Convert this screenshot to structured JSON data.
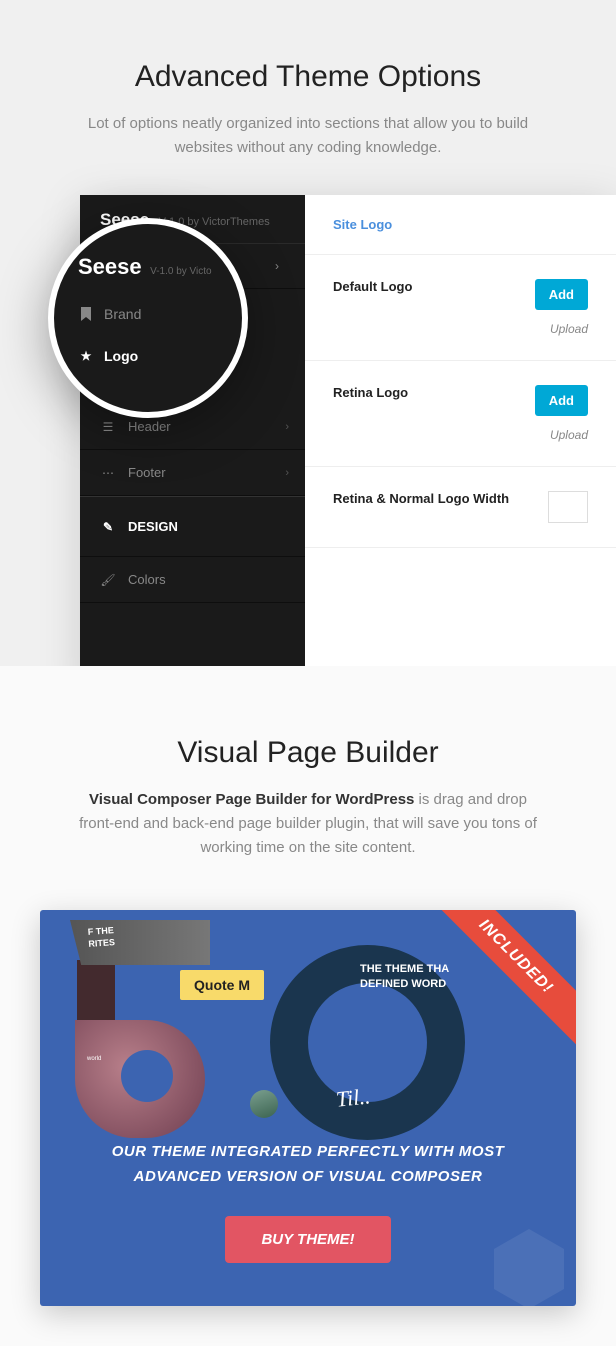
{
  "section1": {
    "title": "Advanced Theme Options",
    "subtitle": "Lot of options neatly organized into sections that allow you to build websites without any coding knowledge."
  },
  "magnifier": {
    "name": "Seese",
    "version": "V-1.0 by Victo",
    "item_brand": "Brand",
    "item_logo": "Logo"
  },
  "sidebar": {
    "name": "Seese",
    "version": "V-1.0 by VictorThemes",
    "items": {
      "top": "",
      "header": "Header",
      "footer": "Footer",
      "design": "DESIGN",
      "colors": "Colors"
    }
  },
  "content": {
    "section_label": "Site Logo",
    "default_logo": "Default Logo",
    "retina_logo": "Retina Logo",
    "width_label": "Retina & Normal Logo Width",
    "add_btn": "Add",
    "upload_hint": "Upload"
  },
  "section2": {
    "title": "Visual Page Builder",
    "bold": "Visual Composer Page Builder for WordPress",
    "rest": " is drag and drop front-end and back-end page builder plugin, that will save you tons of working time on the site content."
  },
  "banner": {
    "ribbon": "INCLUDED!",
    "quote": "Quote M",
    "tag2_l1": "THE THEME THA",
    "tag2_l2": "DEFINED WORD",
    "rib_l1": "F THE",
    "rib_l2": "RITES",
    "world": "world",
    "script": "Til..",
    "text": "OUR THEME INTEGRATED PERFECTLY WITH MOST ADVANCED VERSION OF VISUAL COMPOSER",
    "buy": "BUY THEME!"
  }
}
